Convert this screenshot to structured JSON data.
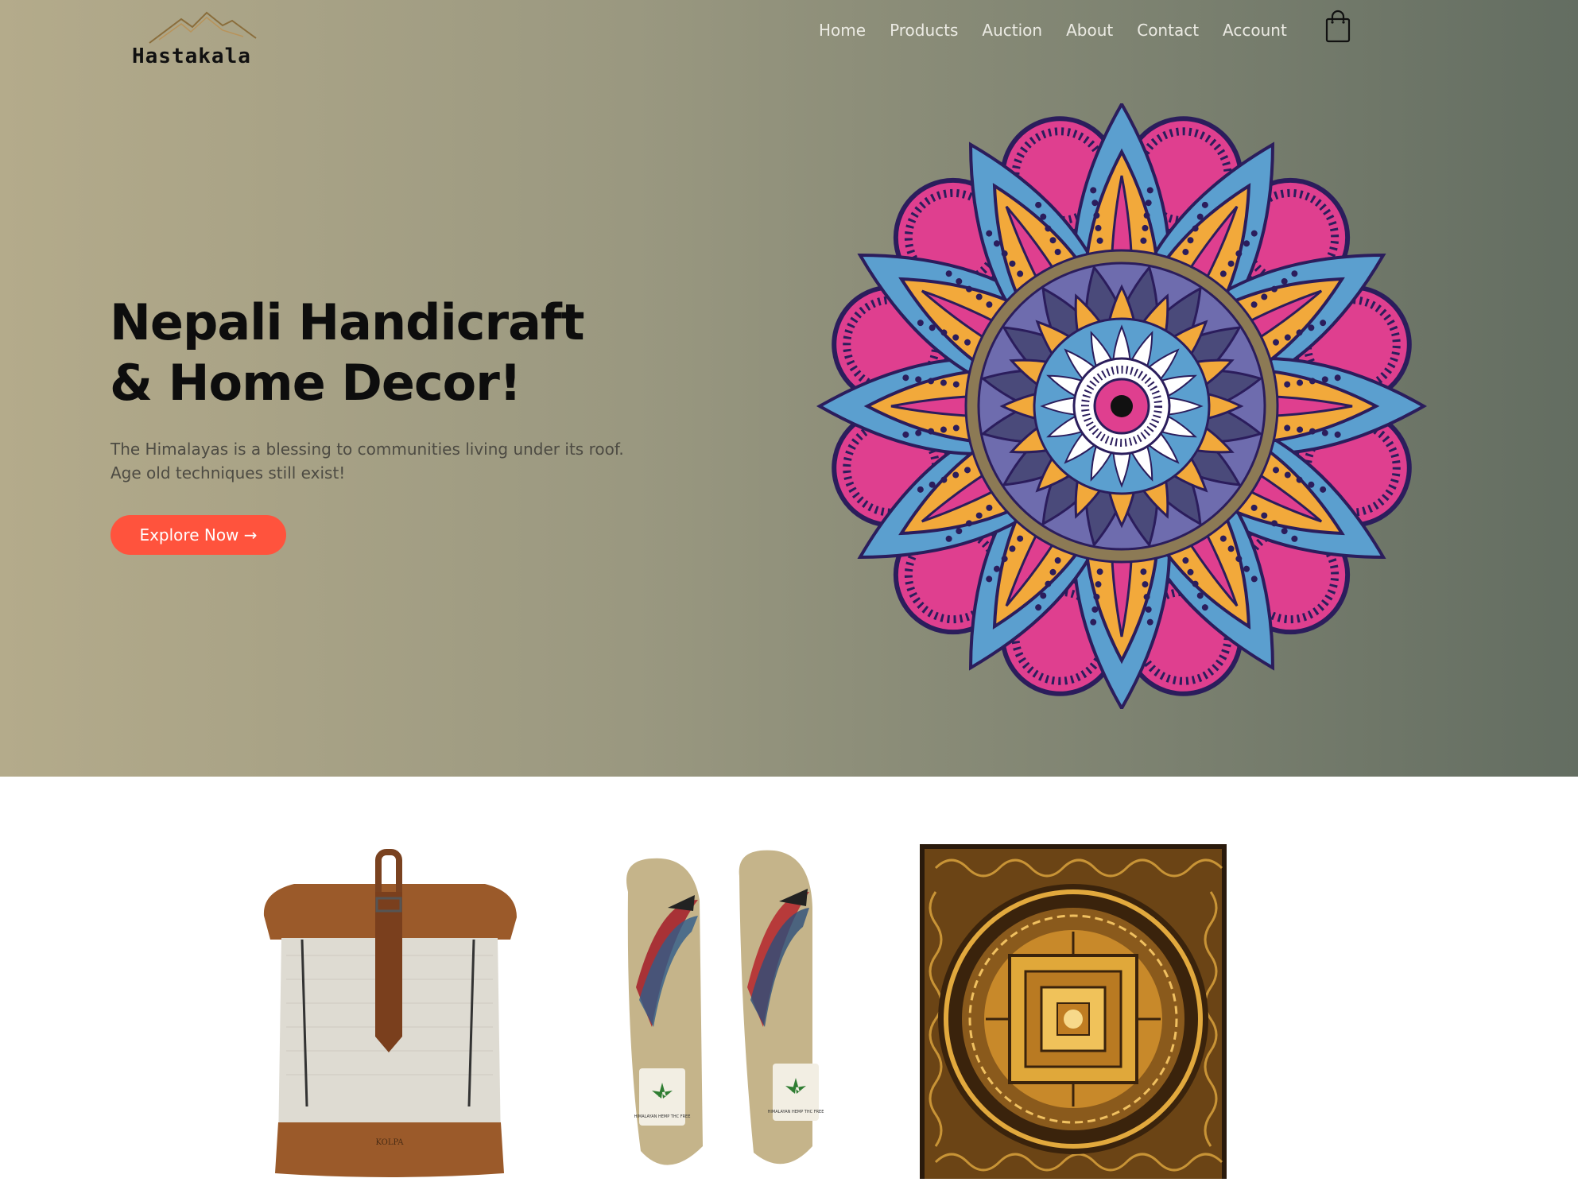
{
  "brand": {
    "name": "Hastakala"
  },
  "nav": {
    "items": [
      {
        "label": "Home"
      },
      {
        "label": "Products"
      },
      {
        "label": "Auction"
      },
      {
        "label": "About"
      },
      {
        "label": "Contact"
      },
      {
        "label": "Account"
      }
    ],
    "cart_icon": "shopping-bag-icon"
  },
  "hero": {
    "title_line1": "Nepali Handicraft",
    "title_line2": "& Home Decor!",
    "subtitle_line1": "The Himalayas is a blessing to communities living under its roof.",
    "subtitle_line2": "Age old techniques still exist!",
    "cta_label": "Explore Now →",
    "illustration": "mandala"
  },
  "products": [
    {
      "image": "hemp-backpack",
      "label": "KOLPA"
    },
    {
      "image": "hemp-sandals",
      "label": "HIMALAYAN HEMP THC FREE"
    },
    {
      "image": "mandala-thangka"
    }
  ],
  "colors": {
    "accent": "#ff533d",
    "hero_left": "#b4ab8b",
    "hero_right": "#636d61",
    "nav_text": "#ecebe4"
  }
}
